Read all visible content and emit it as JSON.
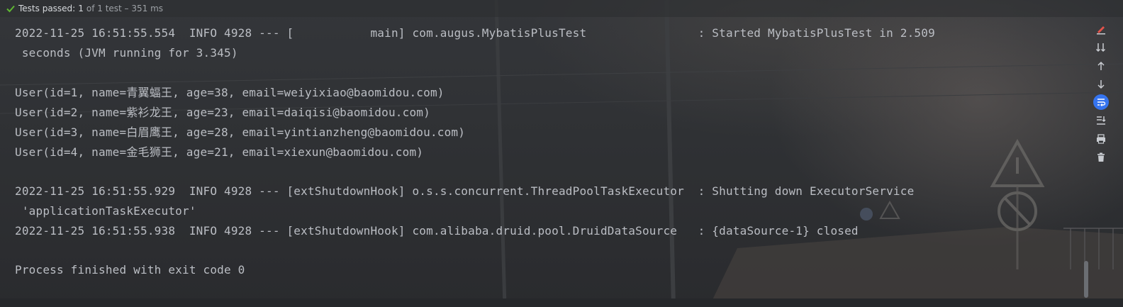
{
  "status_bar": {
    "icon": "check-icon",
    "label": "Tests passed:",
    "count": "1",
    "detail": "of 1 test – 351 ms"
  },
  "console": {
    "truncated_top": "  '  '",
    "lines": [
      "2022-11-25 16:51:55.554  INFO 4928 --- [           main] com.augus.MybatisPlusTest                : Started MybatisPlusTest in 2.509",
      " seconds (JVM running for 3.345)",
      "",
      "User(id=1, name=青翼蝠王, age=38, email=weiyixiao@baomidou.com)",
      "User(id=2, name=紫衫龙王, age=23, email=daiqisi@baomidou.com)",
      "User(id=3, name=白眉鹰王, age=28, email=yintianzheng@baomidou.com)",
      "User(id=4, name=金毛狮王, age=21, email=xiexun@baomidou.com)",
      "",
      "2022-11-25 16:51:55.929  INFO 4928 --- [extShutdownHook] o.s.s.concurrent.ThreadPoolTaskExecutor  : Shutting down ExecutorService",
      " 'applicationTaskExecutor'",
      "2022-11-25 16:51:55.938  INFO 4928 --- [extShutdownHook] com.alibaba.druid.pool.DruidDataSource   : {dataSource-1} closed",
      "",
      "Process finished with exit code 0"
    ]
  },
  "toolbar": {
    "items": [
      "pin-edit-icon",
      "sort-down-icon",
      "arrow-up-icon",
      "arrow-down-icon",
      "soft-wrap-icon",
      "scroll-to-end-icon",
      "print-icon",
      "trash-icon"
    ],
    "active": "soft-wrap-icon",
    "accent": "#3574f0"
  },
  "colors": {
    "text": "#bbbec4",
    "pass": "#5fb832",
    "pin": "#e5534b"
  }
}
